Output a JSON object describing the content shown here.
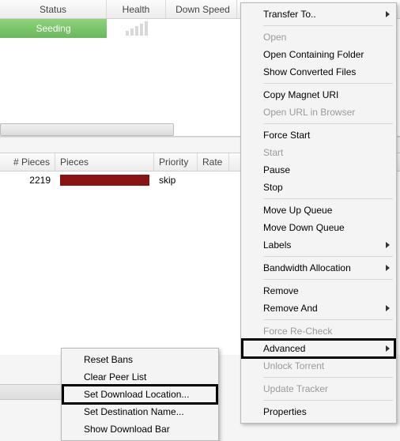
{
  "topHeader": {
    "status": "Status",
    "health": "Health",
    "down": "Down Speed"
  },
  "seedRow": {
    "label": "Seeding"
  },
  "secHeader": {
    "npieces": "# Pieces",
    "pieces": "Pieces",
    "priority": "Priority",
    "rate": "Rate"
  },
  "dataRow": {
    "npieces": "2219",
    "priority": "skip"
  },
  "mainMenu": {
    "transferTo": "Transfer To..",
    "open": "Open",
    "openFolder": "Open Containing Folder",
    "showConverted": "Show Converted Files",
    "copyMagnet": "Copy Magnet URI",
    "openURL": "Open URL in Browser",
    "forceStart": "Force Start",
    "start": "Start",
    "pause": "Pause",
    "stop": "Stop",
    "moveUp": "Move Up Queue",
    "moveDown": "Move Down Queue",
    "labels": "Labels",
    "bandwidth": "Bandwidth Allocation",
    "remove": "Remove",
    "removeAnd": "Remove And",
    "forceRecheck": "Force Re-Check",
    "advanced": "Advanced",
    "unlock": "Unlock Torrent",
    "updateTracker": "Update Tracker",
    "properties": "Properties"
  },
  "subMenu": {
    "resetBans": "Reset Bans",
    "clearPeer": "Clear Peer List",
    "setDownload": "Set Download Location...",
    "setDest": "Set Destination Name...",
    "showDlBar": "Show Download Bar"
  }
}
